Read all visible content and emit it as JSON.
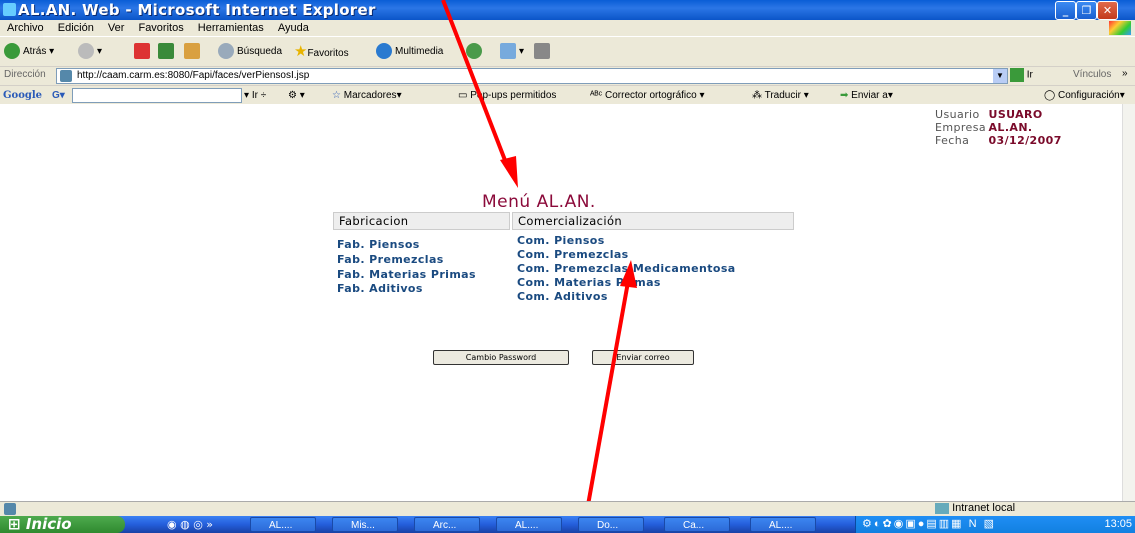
{
  "window": {
    "title": "AL.AN. Web - Microsoft Internet Explorer"
  },
  "menubar": [
    "Archivo",
    "Edición",
    "Ver",
    "Favoritos",
    "Herramientas",
    "Ayuda"
  ],
  "toolbar": {
    "back": "Atrás",
    "search": "Búsqueda",
    "favorites": "Favoritos",
    "multimedia": "Multimedia"
  },
  "address": {
    "label": "Dirección",
    "url": "http://caam.carm.es:8080/Fapi/faces/verPiensosI.jsp",
    "go": "Ir",
    "links": "Vínculos"
  },
  "googlebar": {
    "logo": "Google",
    "g": "G",
    "go": "Ir",
    "bookmarks": "Marcadores",
    "popups": "Pop-ups permitidos",
    "spell": "Corrector ortográfico",
    "translate": "Traducir",
    "send": "Enviar a",
    "settings": "Configuración"
  },
  "userinfo": {
    "usuario_label": "Usuario",
    "usuario": "USUARO",
    "empresa_label": "Empresa",
    "empresa": "AL.AN.",
    "fecha_label": "Fecha",
    "fecha": "03/12/2007"
  },
  "menu": {
    "title": "Menú AL.AN.",
    "col1_header": "Fabricacion",
    "col2_header": "Comercialización",
    "fab": [
      "Fab. Piensos",
      "Fab. Premezclas",
      "Fab. Materias Primas",
      "Fab. Aditivos"
    ],
    "com": [
      "Com. Piensos",
      "Com. Premezclas",
      "Com. Premezclas Medicamentosa",
      "Com. Materias Primas",
      "Com. Aditivos"
    ]
  },
  "buttons": {
    "password": "Cambio Password",
    "mail": "Enviar correo"
  },
  "status": {
    "zone": "Intranet local"
  },
  "taskbar": {
    "start": "Inicio",
    "tasks": [
      "AL....",
      "Mis...",
      "Arc...",
      "AL....",
      "Do...",
      "Ca...",
      "AL...."
    ],
    "clock": "13:05"
  },
  "colors": {
    "title_accent": "#8b0a3a",
    "link": "#1a4a80",
    "arrow": "#ff0000"
  }
}
